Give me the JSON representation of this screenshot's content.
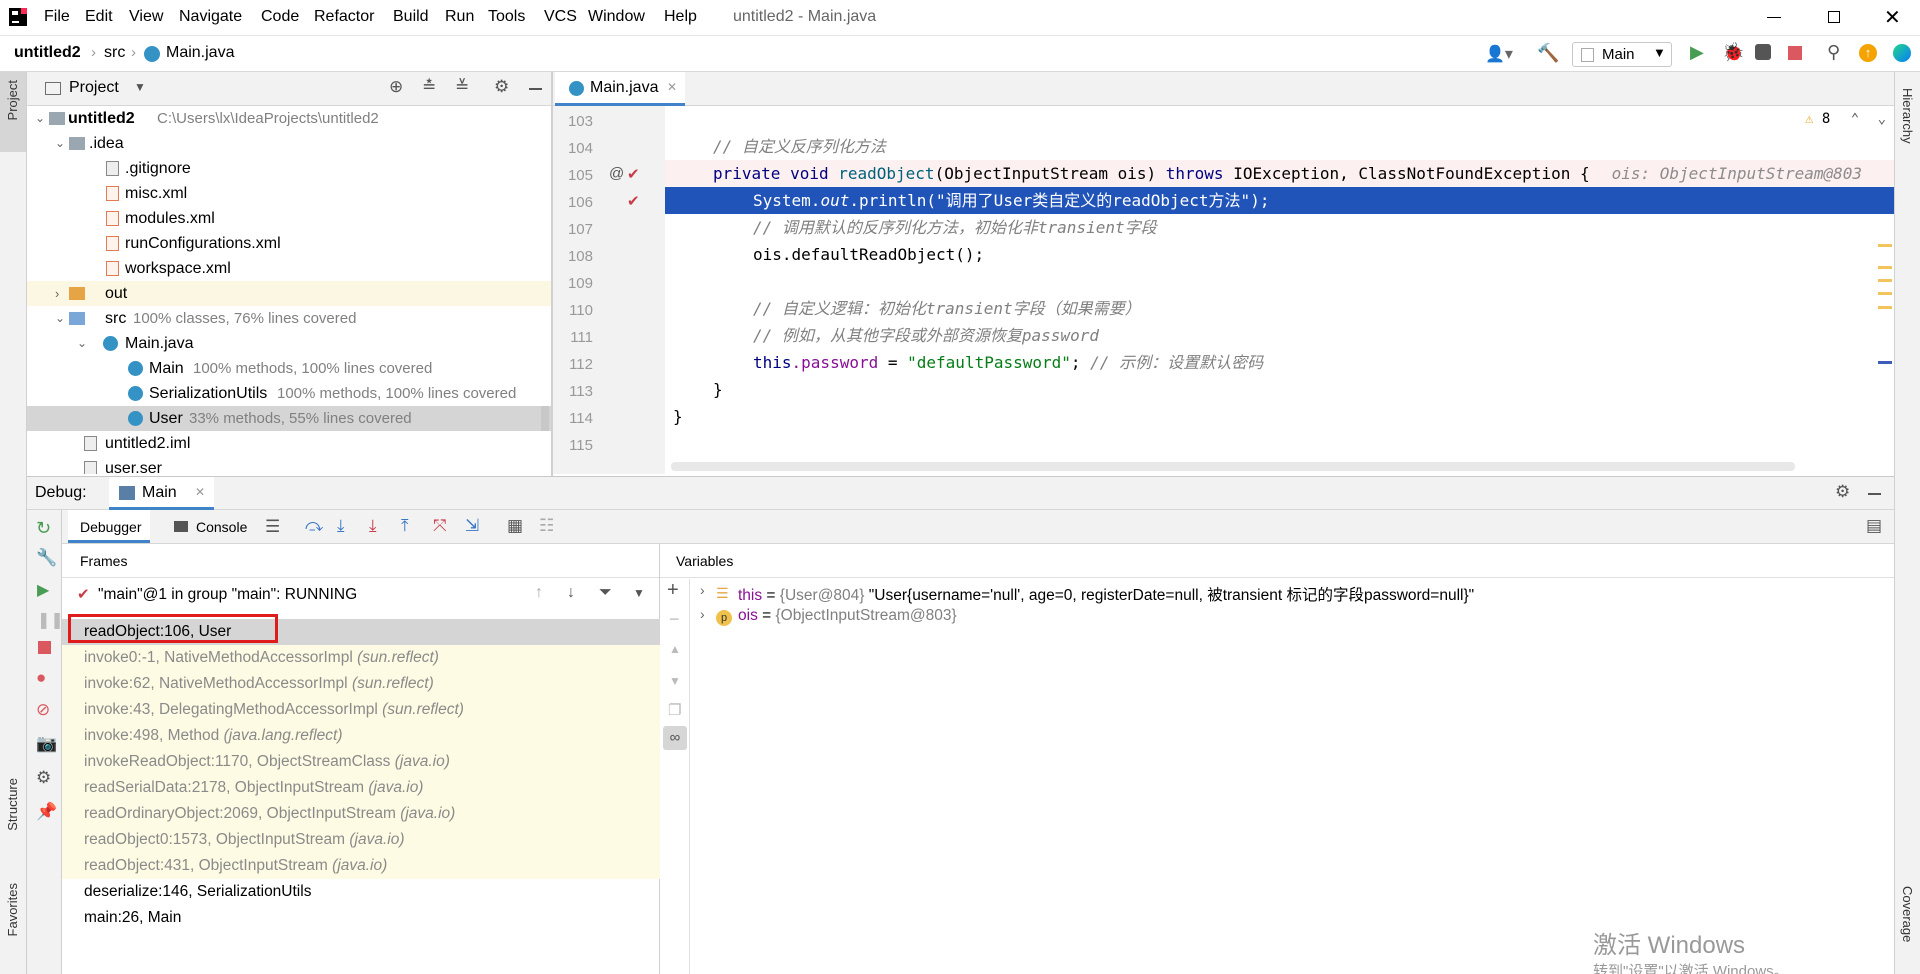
{
  "menubar": {
    "items": [
      "File",
      "Edit",
      "View",
      "Navigate",
      "Code",
      "Refactor",
      "Build",
      "Run",
      "Tools",
      "VCS",
      "Window",
      "Help"
    ],
    "title": "untitled2 - Main.java"
  },
  "navbar": {
    "crumb_project": "untitled2",
    "crumb_src": "src",
    "crumb_file": "Main.java",
    "run_config": "Main"
  },
  "project": {
    "header": "Project",
    "root_name": "untitled2",
    "root_path": "C:\\Users\\lx\\IdeaProjects\\untitled2",
    "idea": ".idea",
    "gitignore": ".gitignore",
    "misc": "misc.xml",
    "modules": "modules.xml",
    "runconf": "runConfigurations.xml",
    "workspace": "workspace.xml",
    "out": "out",
    "src": "src",
    "src_cov": "100% classes, 76% lines covered",
    "mainjava": "Main.java",
    "cls_main": "Main",
    "cls_main_cov": "100% methods, 100% lines covered",
    "cls_ser": "SerializationUtils",
    "cls_ser_cov": "100% methods, 100% lines covered",
    "cls_user": "User",
    "cls_user_cov": "33% methods, 55% lines covered",
    "iml": "untitled2.iml",
    "userser": "user.ser"
  },
  "editor": {
    "tab": "Main.java",
    "warnings": "8",
    "lines": [
      "103",
      "104",
      "105",
      "106",
      "107",
      "108",
      "109",
      "110",
      "111",
      "112",
      "113",
      "114",
      "115"
    ],
    "c104": "// 自定义反序列化方法",
    "c105_kw": "private void ",
    "c105_m": "readObject",
    "c105_a": "(ObjectInputStream ois) ",
    "c105_kw2": "throws ",
    "c105_b": "IOException, ClassNotFoundException {",
    "c105_hint": "ois: ObjectInputStream@803",
    "c106_a": "System.",
    "c106_out": "out",
    "c106_b": ".println(",
    "c106_str": "\"调用了User类自定义的readObject方法\"",
    "c106_c": ");",
    "c107": "// 调用默认的反序列化方法，初始化非transient字段",
    "c108": "ois.defaultReadObject();",
    "c110": "// 自定义逻辑：初始化transient字段（如果需要）",
    "c111": "// 例如，从其他字段或外部资源恢复password",
    "c112_kw": "this",
    "c112_fld": ".password",
    "c112_eq": " = ",
    "c112_str": "\"defaultPassword\"",
    "c112_end": "; ",
    "c112_cm": "// 示例：设置默认密码",
    "c113": "}",
    "c114": "}"
  },
  "debug": {
    "label": "Debug:",
    "session": "Main",
    "tab_debugger": "Debugger",
    "tab_console": "Console",
    "frames_title": "Frames",
    "vars_title": "Variables",
    "thread": "\"main\"@1 in group \"main\": RUNNING",
    "frames": [
      {
        "m": "readObject:106, User",
        "p": ""
      },
      {
        "m": "invoke0:-1, NativeMethodAccessorImpl",
        "p": "(sun.reflect)"
      },
      {
        "m": "invoke:62, NativeMethodAccessorImpl",
        "p": "(sun.reflect)"
      },
      {
        "m": "invoke:43, DelegatingMethodAccessorImpl",
        "p": "(sun.reflect)"
      },
      {
        "m": "invoke:498, Method",
        "p": "(java.lang.reflect)"
      },
      {
        "m": "invokeReadObject:1170, ObjectStreamClass",
        "p": "(java.io)"
      },
      {
        "m": "readSerialData:2178, ObjectInputStream",
        "p": "(java.io)"
      },
      {
        "m": "readOrdinaryObject:2069, ObjectInputStream",
        "p": "(java.io)"
      },
      {
        "m": "readObject0:1573, ObjectInputStream",
        "p": "(java.io)"
      },
      {
        "m": "readObject:431, ObjectInputStream",
        "p": "(java.io)"
      },
      {
        "m": "deserialize:146, SerializationUtils",
        "p": ""
      },
      {
        "m": "main:26, Main",
        "p": ""
      }
    ],
    "var_this_name": "this",
    "var_this_ref": "{User@804}",
    "var_this_val": "\"User{username='null', age=0, registerDate=null, 被transient 标记的字段password=null}\"",
    "var_ois_name": "ois",
    "var_ois_ref": "{ObjectInputStream@803}",
    "eq": " = "
  },
  "strips": {
    "project": "Project",
    "structure": "Structure",
    "favorites": "Favorites",
    "hierarchy": "Hierarchy",
    "coverage": "Coverage"
  },
  "watermark": {
    "line1": "激活 Windows",
    "line2": "转到\"设置\"以激活 Windows。"
  }
}
